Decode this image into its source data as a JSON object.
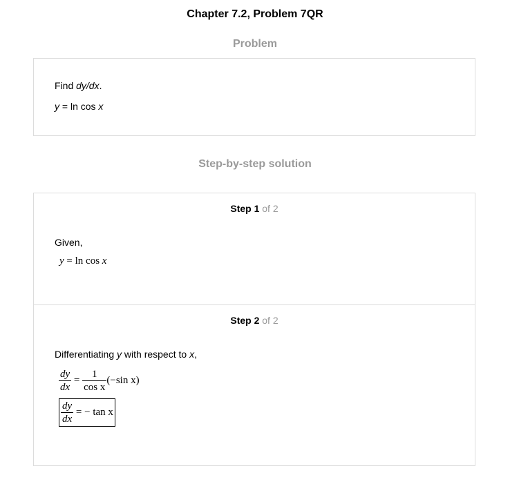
{
  "header": {
    "title": "Chapter 7.2, Problem 7QR",
    "problem_heading": "Problem",
    "solution_heading": "Step-by-step solution"
  },
  "problem": {
    "line1_prefix": "Find ",
    "line1_math": "dy/dx",
    "line1_suffix": ".",
    "line2_y": "y",
    "line2_rest": " = ln cos ",
    "line2_x": "x"
  },
  "steps": [
    {
      "label": "Step 1",
      "of": " of 2",
      "intro": "Given,",
      "eq_lhs": "y",
      "eq_rhs": " = ln cos ",
      "eq_x": "x"
    },
    {
      "label": "Step 2",
      "of": " of 2",
      "intro_prefix": "Differentiating ",
      "intro_y": "y",
      "intro_mid": " with respect to ",
      "intro_x": "x",
      "intro_suffix": ",",
      "eq1_num": "dy",
      "eq1_den": "dx",
      "eq1_eq": " = ",
      "eq1_frac_num": "1",
      "eq1_frac_den": "cos x",
      "eq1_tail": "(−sin x)",
      "eq2_num": "dy",
      "eq2_den": "dx",
      "eq2_rhs": " = − tan x"
    }
  ]
}
